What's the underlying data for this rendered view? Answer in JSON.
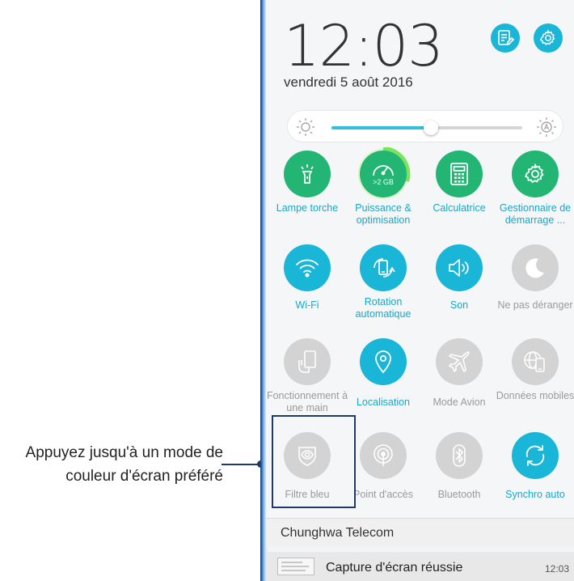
{
  "callout": {
    "line1": "Appuyez jusqu'à un mode de",
    "line2": "couleur d'écran préféré"
  },
  "status": {
    "time": "12:03",
    "date": "vendredi 5 août 2016"
  },
  "header_buttons": [
    {
      "icon": "notes-edit-icon"
    },
    {
      "icon": "gear-icon"
    }
  ],
  "brightness": {
    "level": 0.52,
    "left_icon": "brightness-low-icon",
    "right_icon": "auto-brightness-icon"
  },
  "tiles": [
    {
      "label": "Lampe torche",
      "icon": "flashlight-icon",
      "state": "on"
    },
    {
      "label": "Puissance & optimisation",
      "icon": "speedometer-icon",
      "state": "on",
      "badge": ">2 GB"
    },
    {
      "label": "Calculatrice",
      "icon": "calculator-icon",
      "state": "on"
    },
    {
      "label": "Gestionnaire de démarrage ...",
      "icon": "gear-icon",
      "state": "on"
    },
    {
      "label": "Wi-Fi",
      "icon": "wifi-icon",
      "state": "on"
    },
    {
      "label": "Rotation automatique",
      "icon": "rotation-icon",
      "state": "on"
    },
    {
      "label": "Son",
      "icon": "speaker-icon",
      "state": "on"
    },
    {
      "label": "Ne pas déranger",
      "icon": "moon-icon",
      "state": "off"
    },
    {
      "label": "Fonctionnement à une main",
      "icon": "one-hand-icon",
      "state": "off"
    },
    {
      "label": "Localisation",
      "icon": "location-pin-icon",
      "state": "on"
    },
    {
      "label": "Mode Avion",
      "icon": "airplane-icon",
      "state": "off"
    },
    {
      "label": "Données mobiles",
      "icon": "mobile-data-icon",
      "state": "off"
    },
    {
      "label": "Filtre bleu",
      "icon": "eye-shield-icon",
      "state": "off"
    },
    {
      "label": "Point d'accès",
      "icon": "hotspot-icon",
      "state": "off"
    },
    {
      "label": "Bluetooth",
      "icon": "bluetooth-icon",
      "state": "off"
    },
    {
      "label": "Synchro auto",
      "icon": "sync-icon",
      "state": "on"
    }
  ],
  "notifications": [
    {
      "title": "Chunghwa Telecom"
    },
    {
      "title": "Capture d'écran réussie",
      "time": "12:03"
    }
  ],
  "colors": {
    "on_green": "#22b573",
    "on_cyan": "#19b6d8",
    "off_grey": "#d3d3d3",
    "label_on": "#17a8c8",
    "label_off": "#9a9a9a",
    "highlight": "#1f3a66"
  }
}
